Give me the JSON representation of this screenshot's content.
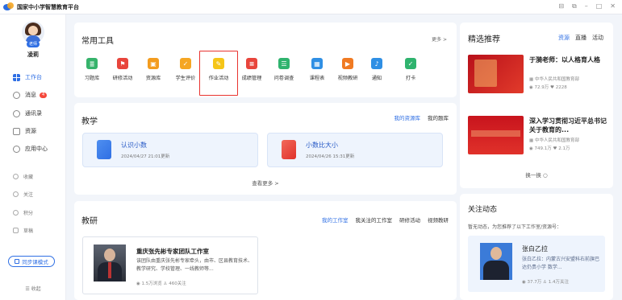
{
  "app": {
    "title": "国家中小学智慧教育平台"
  },
  "window_controls": [
    "⊟",
    "⧉",
    "–",
    "□",
    "✕"
  ],
  "user": {
    "role": "老师",
    "name": "凌莉"
  },
  "sidebar": {
    "items": [
      {
        "label": "工作台"
      },
      {
        "label": "消息",
        "badge": "4"
      },
      {
        "label": "通讯录"
      },
      {
        "label": "资源"
      },
      {
        "label": "应用中心"
      }
    ],
    "minor": [
      {
        "label": "收藏"
      },
      {
        "label": "关注"
      },
      {
        "label": "积分"
      },
      {
        "label": "草稿"
      }
    ],
    "mode_button": "同步课模式",
    "collapse": "☰ 收起"
  },
  "tools": {
    "title": "常用工具",
    "more": "更多 >",
    "items": [
      {
        "label": "习题库",
        "color": "#36b36b",
        "glyph": "≣"
      },
      {
        "label": "研修活动",
        "color": "#e8453c",
        "glyph": "⚑"
      },
      {
        "label": "资源库",
        "color": "#f39c1e",
        "glyph": "▣"
      },
      {
        "label": "学生评价",
        "color": "#f5a623",
        "glyph": "✓"
      },
      {
        "label": "作业活动",
        "color": "#f5c518",
        "glyph": "✎"
      },
      {
        "label": "成绩管理",
        "color": "#e8453c",
        "glyph": "≡"
      },
      {
        "label": "问卷调查",
        "color": "#2fb36e",
        "glyph": "☰"
      },
      {
        "label": "课程表",
        "color": "#2f8fe4",
        "glyph": "▦"
      },
      {
        "label": "视频教研",
        "color": "#f07a22",
        "glyph": "▶"
      },
      {
        "label": "通知",
        "color": "#2f8fe4",
        "glyph": "♪"
      },
      {
        "label": "打卡",
        "color": "#2fb36e",
        "glyph": "✓"
      }
    ]
  },
  "teaching": {
    "title": "教学",
    "tabs": [
      {
        "label": "我的资源库",
        "active": true
      },
      {
        "label": "我的题库",
        "active": false
      }
    ],
    "resources": [
      {
        "title": "认识小数",
        "date": "2024/04/27 21:01更新"
      },
      {
        "title": "小数比大小",
        "date": "2024/04/26 15:31更新"
      }
    ],
    "see_more": "查看更多 >"
  },
  "research": {
    "title": "教研",
    "tabs": [
      {
        "label": "我的工作室",
        "active": true
      },
      {
        "label": "我关注的工作室",
        "active": false
      },
      {
        "label": "研修活动",
        "active": false
      },
      {
        "label": "视频教研",
        "active": false
      }
    ],
    "studio": {
      "name": "重庆张先彬专家团队工作室",
      "desc": "该团队由重庆张先彬专家牵头，由市、区县教育技术、教学研究、学校管理、一线教师等...",
      "stats": "◉ 1.5万浏览  ♙ 460关注"
    }
  },
  "recommend": {
    "title": "精选推荐",
    "tabs": [
      {
        "label": "资源",
        "active": true
      },
      {
        "label": "直播",
        "active": false
      },
      {
        "label": "活动",
        "active": false
      }
    ],
    "items": [
      {
        "title": "于漪老师：以人格育人格",
        "source": "▦ 中华人民共和国教育部",
        "stats": "◉ 72.9万  ♥ 2228"
      },
      {
        "title": "深入学习贯彻习近平总书记关于教育的...",
        "source": "▦ 中华人民共和国教育部",
        "stats": "◉ 749.1万  ♥ 2.1万"
      }
    ],
    "refresh": "换一换 ○"
  },
  "follow": {
    "title": "关注动态",
    "desc": "暂无动态，为您推荐了以下工作室/资源号：",
    "card": {
      "name": "张白乙拉",
      "desc": "张白乙拉：内蒙古兴安盟科右前旗巴达仍贵小学 数学...",
      "stats": "◉ 37.7万  ♙ 1.4万关注"
    }
  }
}
